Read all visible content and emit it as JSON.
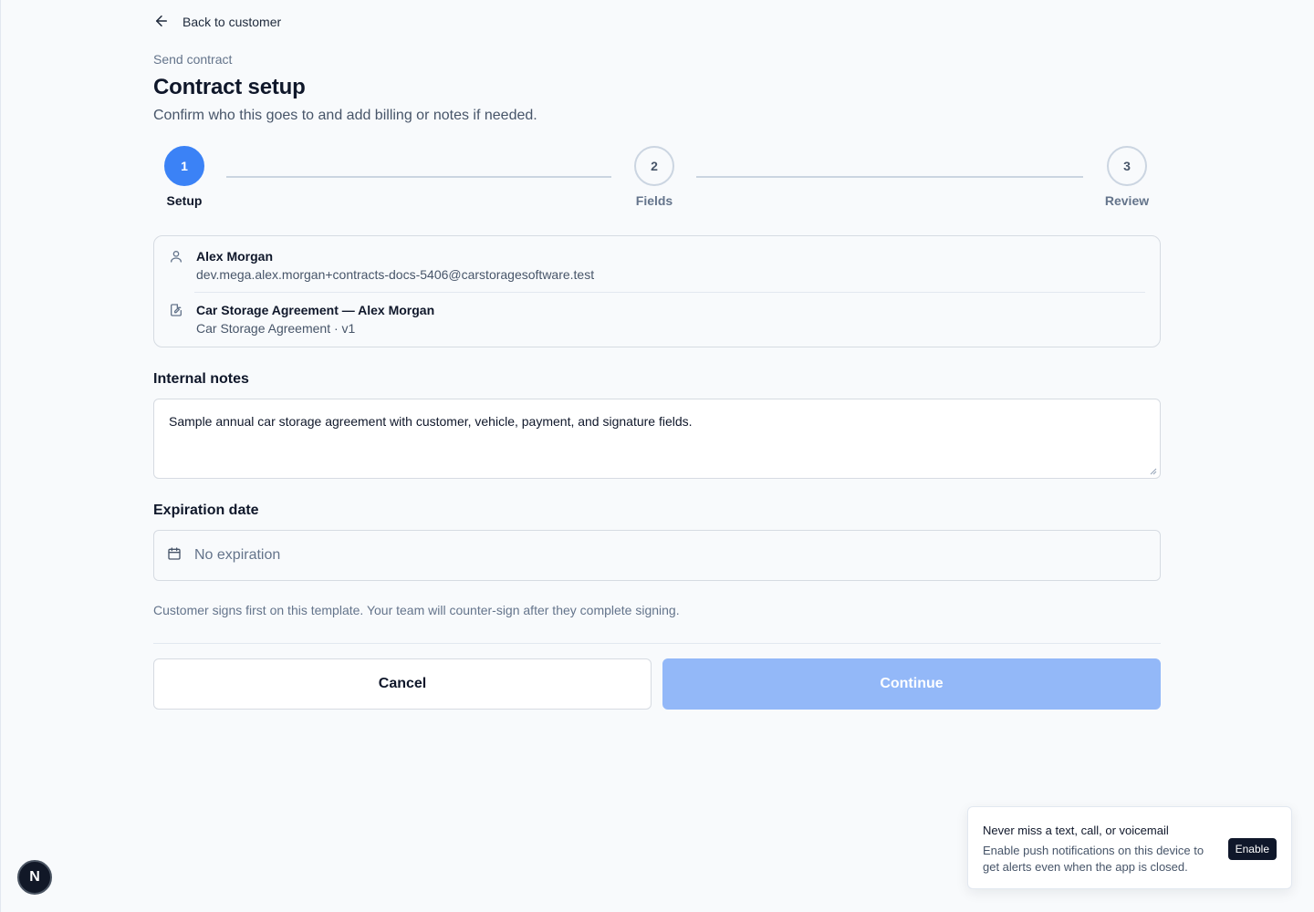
{
  "nav": {
    "back_label": "Back to customer"
  },
  "header": {
    "eyebrow": "Send contract",
    "title": "Contract setup",
    "subtitle": "Confirm who this goes to and add billing or notes if needed."
  },
  "stepper": {
    "active_step": 1,
    "steps": [
      {
        "number": "1",
        "label": "Setup"
      },
      {
        "number": "2",
        "label": "Fields"
      },
      {
        "number": "3",
        "label": "Review"
      }
    ]
  },
  "summary": {
    "customer_name": "Alex Morgan",
    "customer_email": "dev.mega.alex.morgan+contracts-docs-5406@carstoragesoftware.test",
    "contract_name": "Car Storage Agreement — Alex Morgan",
    "contract_meta": "Car Storage Agreement · v1"
  },
  "notes": {
    "label": "Internal notes",
    "value": "Sample annual car storage agreement with customer, vehicle, payment, and signature fields."
  },
  "expiration": {
    "label": "Expiration date",
    "value": "No expiration"
  },
  "signing_note": "Customer signs first on this template. Your team will counter-sign after they complete signing.",
  "actions": {
    "cancel_label": "Cancel",
    "continue_label": "Continue"
  },
  "badge": {
    "letter": "N"
  },
  "toast": {
    "title": "Never miss a text, call, or voicemail",
    "body": "Enable push notifications on this device to get alerts even when the app is closed.",
    "button_label": "Enable"
  },
  "colors": {
    "accent": "#3b82f6",
    "accent_disabled": "#93b8f8",
    "text": "#0f172a",
    "muted": "#64748b",
    "border": "#d6dbe2",
    "background": "#f8fafc"
  }
}
